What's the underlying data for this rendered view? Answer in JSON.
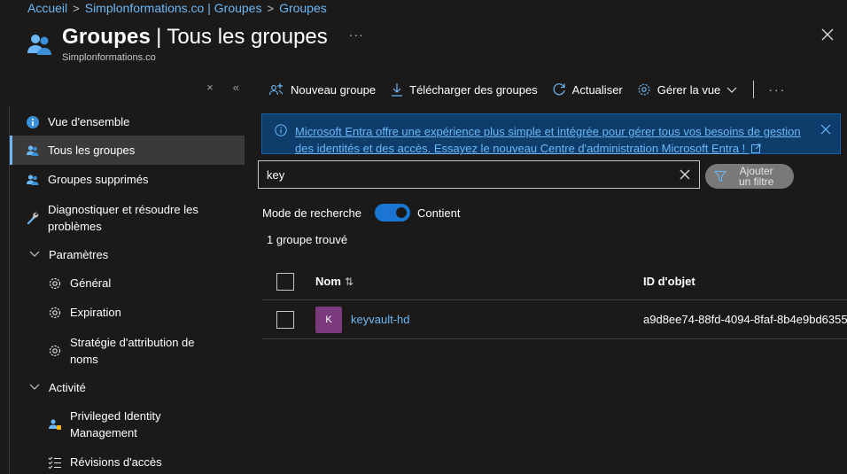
{
  "breadcrumb": {
    "items": [
      "Accueil",
      "Simplonformations.co | Groupes",
      "Groupes"
    ]
  },
  "header": {
    "title": "Groupes",
    "separator": "|",
    "subtitle": "Tous les groupes",
    "more": "···",
    "tenant": "Simplonformations.co"
  },
  "sidebar": {
    "collapse_icons": [
      "×",
      "«"
    ],
    "items": [
      {
        "label": "Vue d'ensemble",
        "icon": "info-icon"
      },
      {
        "label": "Tous les groupes",
        "icon": "group-icon",
        "active": true
      },
      {
        "label": "Groupes supprimés",
        "icon": "group-icon"
      },
      {
        "label": "Diagnostiquer et résoudre les problèmes",
        "icon": "wrench-icon"
      },
      {
        "label": "Paramètres",
        "icon": "chevron-down-icon"
      },
      {
        "label": "Général",
        "icon": "gear-icon"
      },
      {
        "label": "Expiration",
        "icon": "gear-icon"
      },
      {
        "label": "Stratégie d'attribution de noms",
        "icon": "gear-icon"
      },
      {
        "label": "Activité",
        "icon": "chevron-down-icon"
      },
      {
        "label": "Privileged Identity Management",
        "icon": "pim-icon"
      },
      {
        "label": "Révisions d'accès",
        "icon": "list-check-icon"
      }
    ]
  },
  "toolbar": {
    "new_group": "Nouveau groupe",
    "download": "Télécharger des groupes",
    "refresh": "Actualiser",
    "manage_view": "Gérer la vue",
    "more": "···"
  },
  "banner": {
    "text": "Microsoft Entra offre une expérience plus simple et intégrée pour gérer tous vos besoins de gestion des identités et des accès. Essayez le nouveau Centre d'administration Microsoft Entra !"
  },
  "search": {
    "value": "key"
  },
  "filter": {
    "label_line1": "Ajouter",
    "label_line2": "un filtre"
  },
  "search_mode": {
    "label": "Mode de recherche",
    "value": "Contient",
    "on": true
  },
  "results": {
    "count_text": "1 groupe trouvé"
  },
  "table": {
    "columns": {
      "name": "Nom",
      "sort_icon": "⇅",
      "object_id": "ID d'objet"
    },
    "rows": [
      {
        "initial": "K",
        "name": "keyvault-hd",
        "object_id": "a9d8ee74-88fd-4094-8faf-8b4e9bd6355"
      }
    ]
  },
  "colors": {
    "accent": "#6cb8f6",
    "banner_bg": "#0e3c6b",
    "toggle": "#1a76d2",
    "avatar": "#7a3a7c"
  }
}
